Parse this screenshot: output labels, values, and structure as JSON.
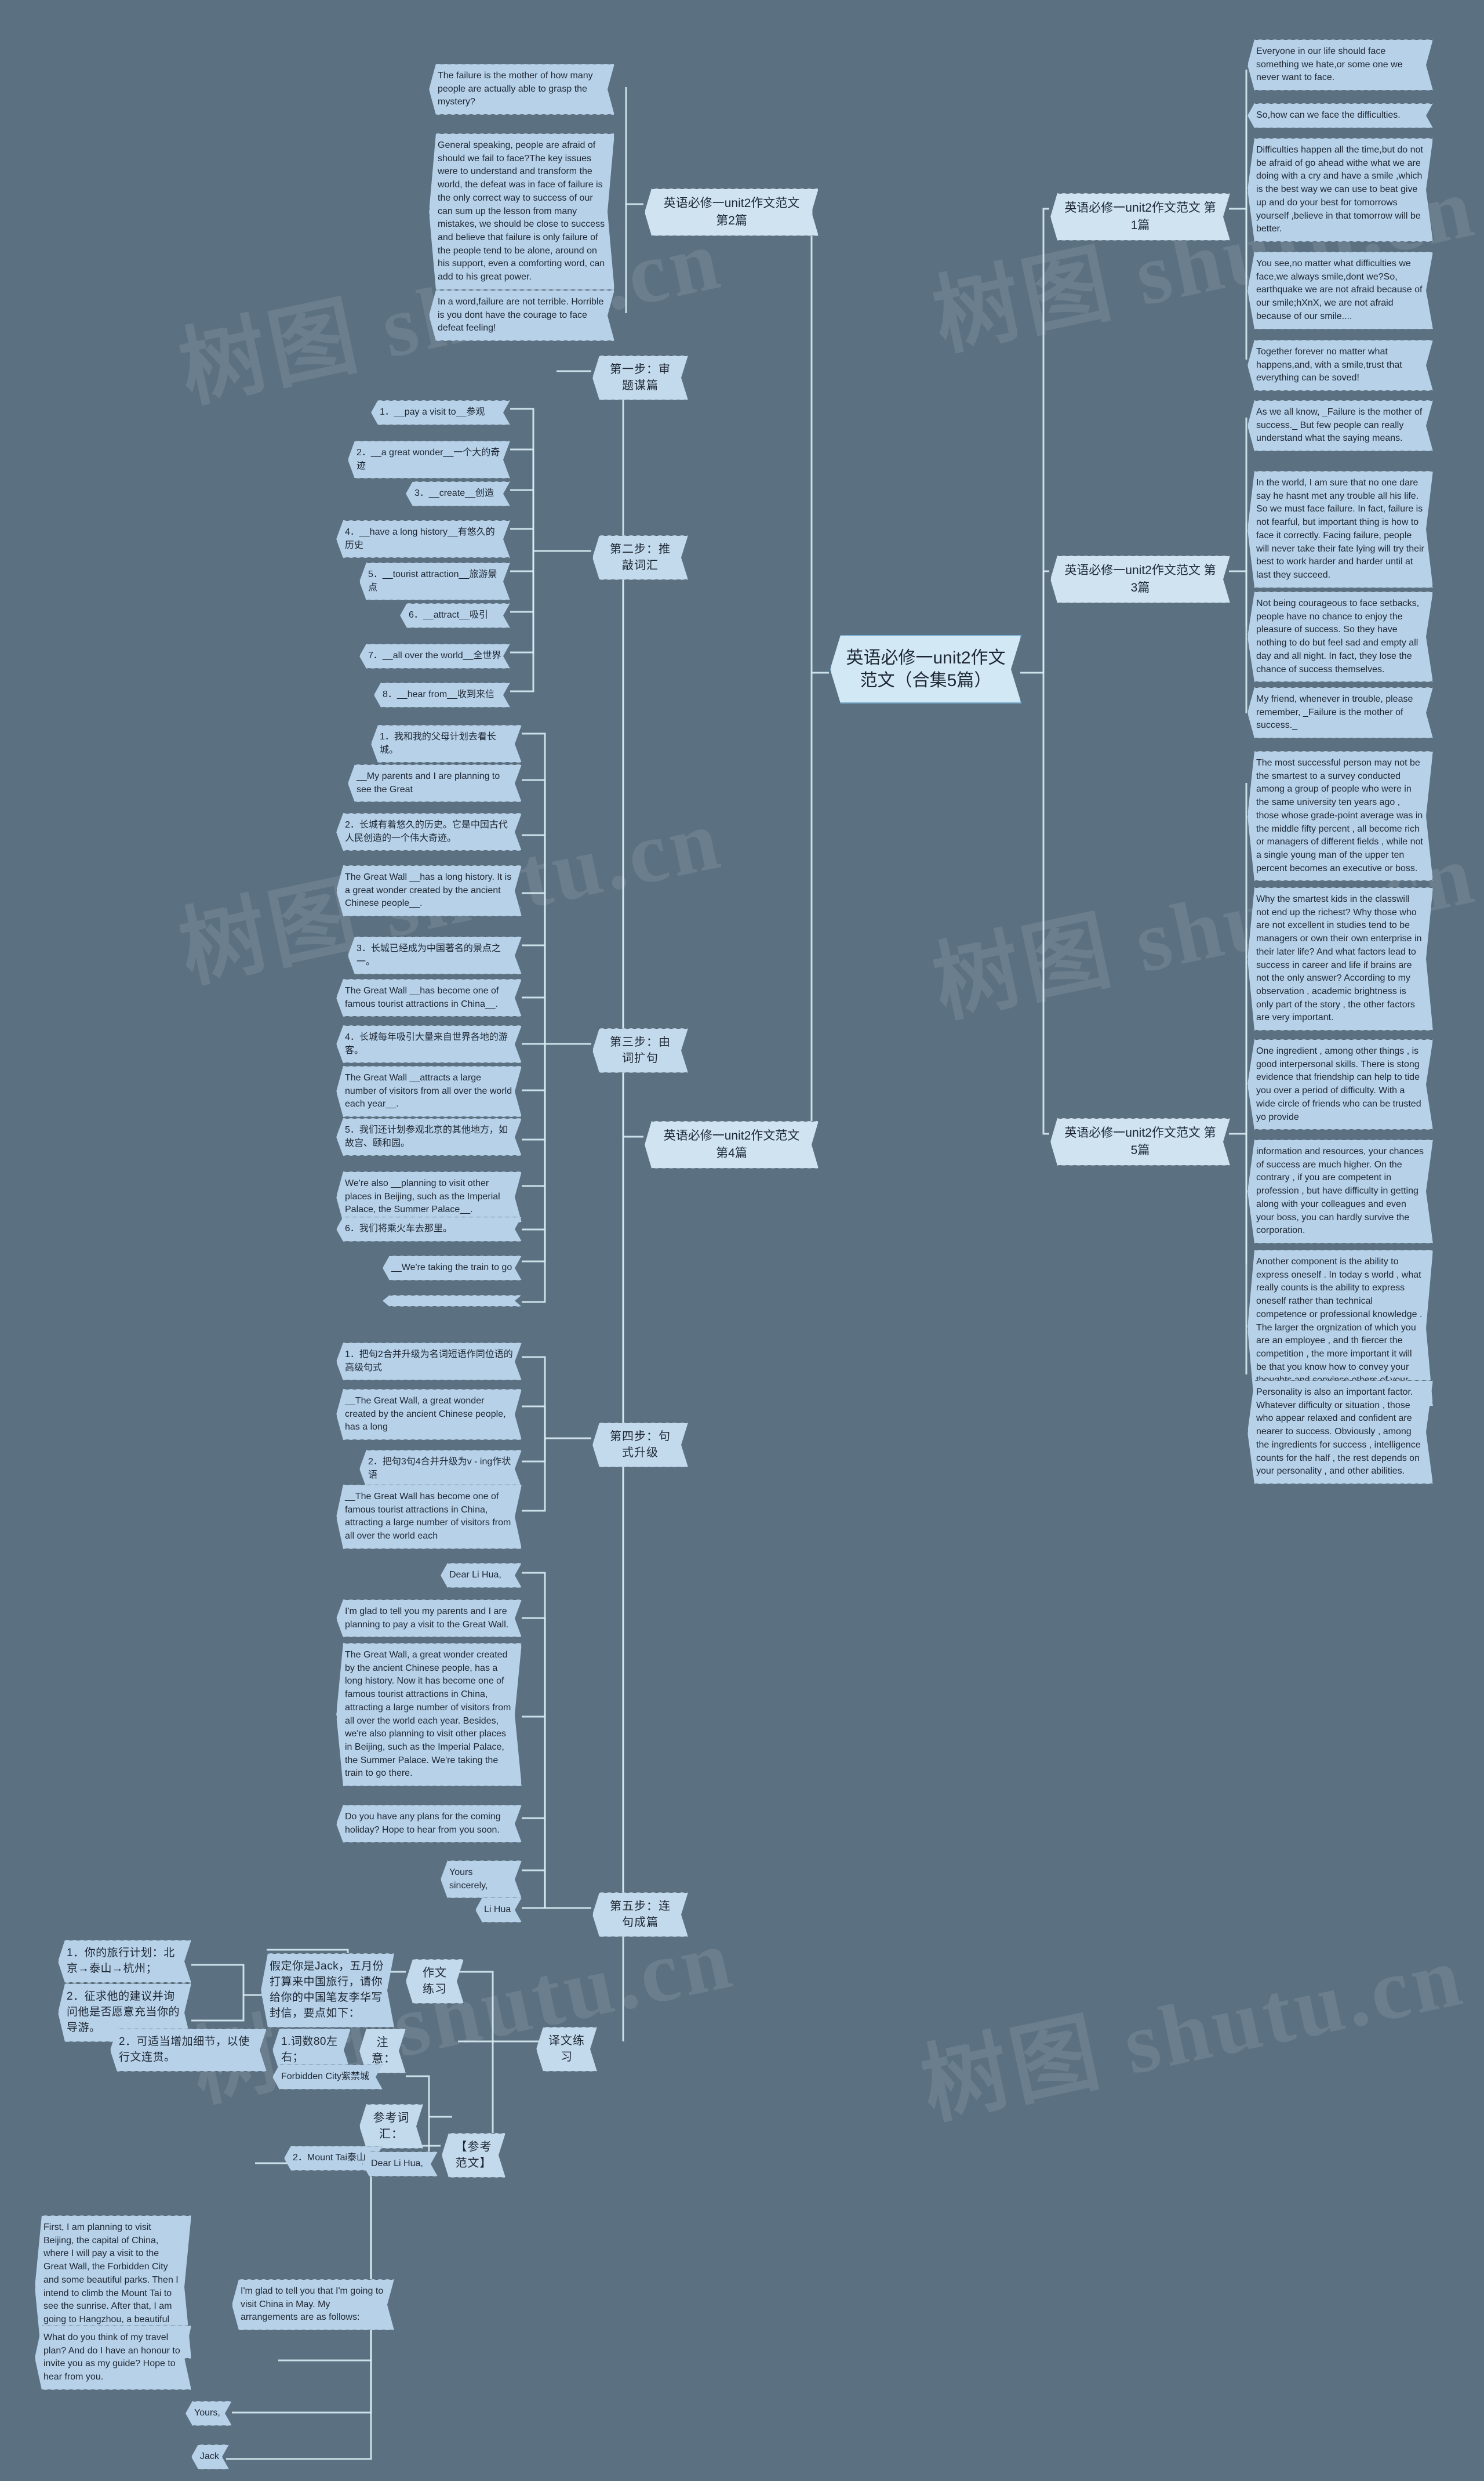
{
  "center": {
    "title": "英语必修一unit2作文范文（合集5篇）"
  },
  "watermarks": [
    "树图 shutu.cn",
    "树图 shutu.cn",
    "树图 shutu.cn",
    "树图 shutu.cn",
    "树图 shutu.cn",
    "树图 shutu.cn"
  ],
  "branches": {
    "p2": "英语必修一unit2作文范文 第2篇",
    "p4": "英语必修一unit2作文范文 第4篇",
    "p1": "英语必修一unit2作文范文 第1篇",
    "p3": "英语必修一unit2作文范文 第3篇",
    "p5": "英语必修一unit2作文范文 第5篇"
  },
  "steps": {
    "s1": "第一步：审题谋篇",
    "s2": "第二步：推敲词汇",
    "s3": "第三步：由词扩句",
    "s4": "第四步：句式升级",
    "s5": "第五步：连句成篇",
    "translation_practice": "译文练习",
    "reference_answer": "【参考范文】",
    "writing_practice": "作文练习",
    "notice": "注意：",
    "vocab_ref": "参考词汇："
  },
  "essay2": {
    "n1": "The failure is the mother of  how many people are actually able to grasp the mystery?",
    "n2": "General speaking, people are afraid of should we fail to face?The key issues were to  understand and transform the world, the defeat was  in face of failure is the only correct way to success of our can sum up the lesson from  many mistakes, we should be close to success and believe that failure is only  failure of the people tend to be alone, around on his support, even a comforting word, can add to his great power.",
    "n3": "In a word,failure are not terrible. Horrible is you dont have the courage to face defeat feeling!"
  },
  "essay1": {
    "n1": "Everyone in our life should face something we hate,or some one we never want to face.",
    "n2": "So,how can we face the difficulties.",
    "n3": "Difficulties happen all the time,but do not be afraid of  go ahead withe what we are  doing with a  cry and have a smile ,which is the best way we can use to beat  give up and do your best for tomorrows yourself ,believe in that tomorrow will be better.",
    "n4": "You see,no matter what difficulties we face,we always smile,dont we?So, earthquake we are not afraid because of our smile;hXnX, we are not afraid because of our smile....",
    "n5": "Together forever no matter what happens,and, with a smile,trust that everything can be soved!"
  },
  "essay3": {
    "n1": "As we all know, _Failure is the mother of success._ But few people can really understand what the saying means.",
    "n2": "In the world, I am sure that no one dare say he hasnt met any trouble all his life. So we must face failure. In fact, failure is not fearful, but important thing is how to face it correctly. Facing failure, people will never take their fate lying  will try their best to work harder and harder until at last they succeed.",
    "n3": "Not being courageous to face setbacks, people have no chance to enjoy the pleasure of success. So they have nothing  to do but feel sad and empty all day and  all night. In fact, they lose the chance of success themselves.",
    "n4": "My friend, whenever in trouble, please remember, _Failure is the mother of success._"
  },
  "essay5": {
    "n1": "The most successful person may not be the smartest  to a survey conducted among a group of people who were in the same university ten years ago , those whose grade-point average was in the middle fifty percent , all become rich or managers of different fields , while not a single young man of the upper ten percent becomes an executive or boss.",
    "n2": "Why the smartest kids in the classwill not  end up the richest? Why those who are not excellent in studies tend to be managers or own their own enterprise in their later life? And what factors lead to success in career and life if brains are not the only answer? According to my observation , academic brightness is only part of the story , the other factors are very important.",
    "n3": "One ingredient , among other things , is good interpersonal skills. There is stong evidence that friendship can help to tide you over a period of difficulty. With a wide circle of friends who can be trusted yo provide",
    "n4": "information and resources, your chances of success are much higher. On the contrary , if you are competent in profession , but have difficulty in getting along with your colleagues and even your boss, you can hardly survive the corporation.",
    "n5": "Another component is the ability to express oneself . In today s world , what really counts is the ability to express oneself rather than technical competence  or professional knowledge . The larger the orgnization of which you are an employee , and th fiercer the competition , the more important it will be that you know how to convey your thoughts and convince others of your ideas.",
    "n6": "Personality is also an important factor. Whatever difficulty or situation , those who appear relaxed and confident are nearer to success. Obviously , among the ingredients for success , intelligence counts for the half , the rest depends on your personality , and other abilities."
  },
  "vocab": [
    "1．__pay a visit to__参观",
    "2．__a great wonder__一个大的奇迹",
    "3．__create__创造",
    "4．__have a long history__有悠久的历史",
    "5．__tourist attraction__旅游景点",
    "6．__attract__吸引",
    "7．__all over the world__全世界",
    "8．__hear from__收到来信"
  ],
  "expand": [
    "1．我和我的父母计划去看长城。",
    "__My parents and I are planning to see the Great",
    "2．长城有着悠久的历史。它是中国古代人民创造的一个伟大奇迹。",
    "The Great Wall __has a long history. It is a great wonder created by the ancient Chinese people__.",
    "3．长城已经成为中国著名的景点之一。",
    "The Great Wall __has become one of famous tourist attractions in China__.",
    "4．长城每年吸引大量来自世界各地的游客。",
    "The Great Wall __attracts a large number of visitors from all over the world each year__.",
    "5．我们还计划参观北京的其他地方，如故宫、颐和园。",
    "We're also __planning to visit other places in Beijing, such as the Imperial Palace, the Summer Palace__.",
    "6．我们将乘火车去那里。",
    "__We're taking the train to go"
  ],
  "upgrade": [
    "1．把句2合并升级为名词短语作同位语的高级句式",
    "__The Great Wall, a great wonder created by the ancient Chinese people, has a long",
    "2．把句3句4合并升级为v - ing作状语",
    "__The Great Wall has become one of famous tourist attractions in China, attracting a large number of visitors from all over the world each"
  ],
  "letter4": {
    "greeting": "Dear Li Hua,",
    "p1": "I'm glad to tell you my parents and I are planning to pay a visit to the Great Wall.",
    "p2": "The Great Wall, a great wonder created by the ancient Chinese people, has a long history. Now it has become one of famous tourist attractions in China, attracting a large number of visitors from all over the world each year. Besides, we're also planning to visit other places in Beijing, such as the Imperial Palace, the Summer Palace. We're taking the train to go there.",
    "p3": "Do you have any plans for the coming holiday? Hope to hear from you soon.",
    "closing": "Yours sincerely,",
    "sign": "Li Hua"
  },
  "practice": {
    "prompt": "假定你是Jack，五月份打算来中国旅行，请你给你的中国笔友李华写封信，要点如下：",
    "point1": "1．你的旅行计划：北京→泰山→杭州；",
    "point2": "2．征求他的建议并询问他是否愿意充当你的导游。",
    "note1": "1.词数80左右；",
    "note2": "2．可适当增加细节，以使行文连贯。",
    "vocab1": "Forbidden City紫禁城",
    "vocab2": "2．Mount Tai泰山"
  },
  "letter5": {
    "greeting": "Dear Li Hua,",
    "p1": "I'm glad to tell you that I'm going to visit China in May. My arrangements are as follows:",
    "p2": "First, I am planning to visit Beijing, the capital of China, where I will pay a visit to the Great Wall, the Forbidden City and some beautiful parks. Then I intend to climb the Mount Tai to see the sunrise. After that, I am going to Hangzhou, a beautiful city which is famous for West Lake.",
    "p3": "What do you think of my travel plan? And do I have an honour to invite you as my guide? Hope to hear from you.",
    "closing": "Yours,",
    "sign": "Jack"
  }
}
